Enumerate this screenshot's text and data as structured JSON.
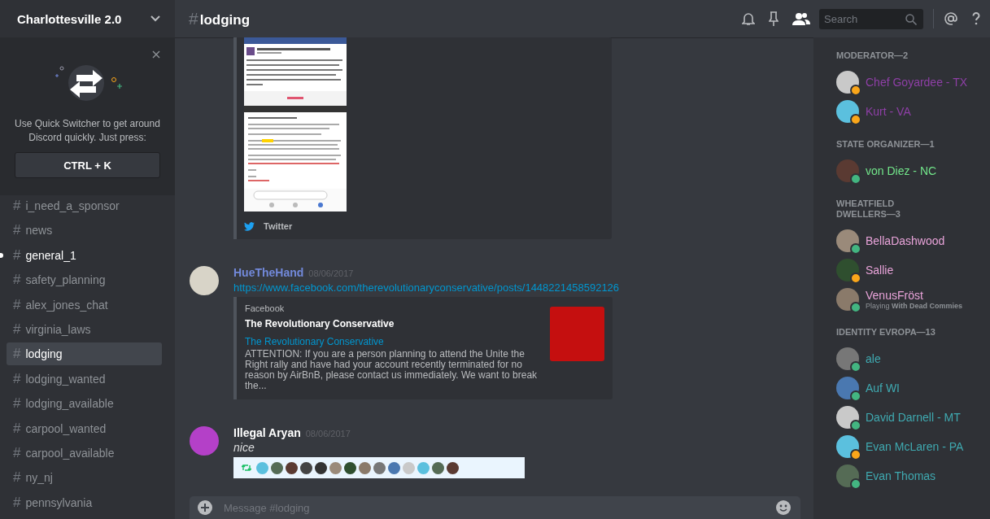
{
  "server": {
    "name": "Charlottesville 2.0"
  },
  "quick_switcher": {
    "text": "Use Quick Switcher to get around Discord quickly. Just press:",
    "shortcut": "CTRL + K"
  },
  "channels": [
    {
      "hash": "#",
      "name": "i_need_a_sponsor",
      "selected": false,
      "unread": false
    },
    {
      "hash": "#",
      "name": "news",
      "selected": false,
      "unread": false
    },
    {
      "hash": "#",
      "name": "general_1",
      "selected": false,
      "unread": true
    },
    {
      "hash": "#",
      "name": "safety_planning",
      "selected": false,
      "unread": false
    },
    {
      "hash": "#",
      "name": "alex_jones_chat",
      "selected": false,
      "unread": false
    },
    {
      "hash": "#",
      "name": "virginia_laws",
      "selected": false,
      "unread": false
    },
    {
      "hash": "#",
      "name": "lodging",
      "selected": true,
      "unread": false
    },
    {
      "hash": "#",
      "name": "lodging_wanted",
      "selected": false,
      "unread": false
    },
    {
      "hash": "#",
      "name": "lodging_available",
      "selected": false,
      "unread": false
    },
    {
      "hash": "#",
      "name": "carpool_wanted",
      "selected": false,
      "unread": false
    },
    {
      "hash": "#",
      "name": "carpool_available",
      "selected": false,
      "unread": false
    },
    {
      "hash": "#",
      "name": "ny_nj",
      "selected": false,
      "unread": false
    },
    {
      "hash": "#",
      "name": "pennsylvania",
      "selected": false,
      "unread": false
    }
  ],
  "channel_header": {
    "hash": "#",
    "name": "lodging"
  },
  "search": {
    "placeholder": "Search"
  },
  "top_embed": {
    "footer": "Twitter"
  },
  "messages": [
    {
      "kind": "link_embed",
      "author": "HueTheHand",
      "color": "#7289da",
      "timestamp": "08/06/2017",
      "link": "https://www.facebook.com/therevolutionaryconservative/posts/1448221458592126",
      "embed": {
        "provider": "Facebook",
        "title": "The Revolutionary Conservative",
        "link_title": "The Revolutionary Conservative",
        "description": "ATTENTION: If you are a person planning to attend the Unite the Right rally and have had your account recently terminated for no reason by AirBnB, please contact us immediately. We want to break the..."
      }
    },
    {
      "kind": "text_image",
      "author": "Illegal Aryan",
      "color": "#ffffff",
      "timestamp": "08/06/2017",
      "text": "nice"
    }
  ],
  "composer": {
    "placeholder": "Message #lodging"
  },
  "member_groups": [
    {
      "title": "MODERATOR—2",
      "color": "#8e3fa6",
      "members": [
        {
          "name": "Chef Goyardee - TX",
          "color": "#faa61a"
        },
        {
          "name": "Kurt - VA",
          "color": "#faa61a"
        }
      ]
    },
    {
      "title": "STATE ORGANIZER—1",
      "color": "#72e58a",
      "members": [
        {
          "name": "von Diez - NC",
          "color": "#43b581"
        }
      ]
    },
    {
      "title": "WHEATFIELD DWELLERS—3",
      "color": "#e8a3d9",
      "members": [
        {
          "name": "BellaDashwood",
          "color": "#43b581"
        },
        {
          "name": "Sallie",
          "color": "#faa61a"
        },
        {
          "name": "VenusFröst",
          "color": "#43b581",
          "activity": "Playing **With Dead Commies**"
        }
      ]
    },
    {
      "title": "IDENTITY EVROPA—13",
      "color": "#3fa9b0",
      "members": [
        {
          "name": "ale",
          "color": "#43b581"
        },
        {
          "name": "Auf WI",
          "color": "#43b581"
        },
        {
          "name": "David Darnell - MT",
          "color": "#43b581"
        },
        {
          "name": "Evan McLaren - PA",
          "color": "#faa61a"
        },
        {
          "name": "Evan Thomas",
          "color": "#43b581"
        }
      ]
    }
  ]
}
